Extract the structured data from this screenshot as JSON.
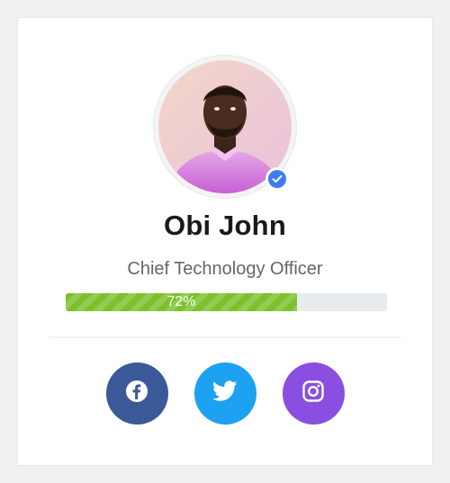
{
  "profile": {
    "name": "Obi John",
    "title": "Chief Technology Officer",
    "verified": true
  },
  "progress": {
    "percent": 72,
    "label": "72%",
    "color": "#7cc02b"
  },
  "socials": [
    {
      "name": "facebook",
      "icon": "facebook-icon",
      "color": "#3b5998"
    },
    {
      "name": "twitter",
      "icon": "twitter-icon",
      "color": "#1da1f2"
    },
    {
      "name": "instagram",
      "icon": "instagram-icon",
      "color": "#8a4fe0"
    }
  ]
}
